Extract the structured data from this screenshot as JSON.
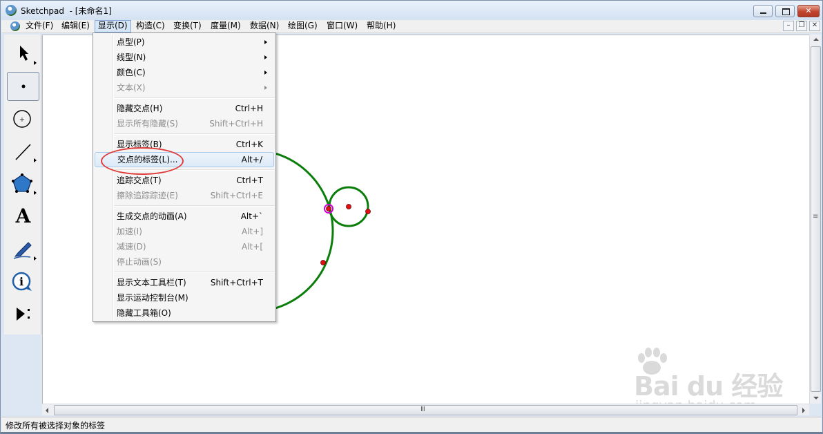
{
  "window": {
    "title": "Sketchpad  - [未命名1]"
  },
  "menubar": {
    "items": [
      {
        "label": "文件(F)",
        "active": false
      },
      {
        "label": "编辑(E)",
        "active": false
      },
      {
        "label": "显示(D)",
        "active": true
      },
      {
        "label": "构造(C)",
        "active": false
      },
      {
        "label": "变换(T)",
        "active": false
      },
      {
        "label": "度量(M)",
        "active": false
      },
      {
        "label": "数据(N)",
        "active": false
      },
      {
        "label": "绘图(G)",
        "active": false
      },
      {
        "label": "窗口(W)",
        "active": false
      },
      {
        "label": "帮助(H)",
        "active": false
      }
    ],
    "mdi_controls": [
      "minimize-doc",
      "restore-doc",
      "close-doc"
    ]
  },
  "toolbox": {
    "tools": [
      {
        "name": "arrow-tool",
        "icon": "select-arrow-icon"
      },
      {
        "name": "point-tool",
        "icon": "point-icon",
        "selected": true
      },
      {
        "name": "compass-tool",
        "icon": "circle-icon"
      },
      {
        "name": "straightedge-tool",
        "icon": "line-icon"
      },
      {
        "name": "polygon-tool",
        "icon": "pentagon-icon"
      },
      {
        "name": "text-tool",
        "icon": "text-A-icon",
        "text": "A"
      },
      {
        "name": "marker-tool",
        "icon": "pen-icon"
      },
      {
        "name": "information-tool",
        "icon": "info-icon"
      },
      {
        "name": "custom-tool",
        "icon": "play-dots-icon"
      }
    ]
  },
  "dropdown": {
    "groups": [
      [
        {
          "label": "点型(P)",
          "submenu": true,
          "disabled": false
        },
        {
          "label": "线型(N)",
          "submenu": true,
          "disabled": false
        },
        {
          "label": "颜色(C)",
          "submenu": true,
          "disabled": false
        },
        {
          "label": "文本(X)",
          "submenu": true,
          "disabled": true
        }
      ],
      [
        {
          "label": "隐藏交点(H)",
          "shortcut": "Ctrl+H",
          "disabled": false
        },
        {
          "label": "显示所有隐藏(S)",
          "shortcut": "Shift+Ctrl+H",
          "disabled": true
        }
      ],
      [
        {
          "label": "显示标签(B)",
          "shortcut": "Ctrl+K",
          "disabled": false
        },
        {
          "label": "交点的标签(L)...",
          "shortcut": "Alt+/",
          "disabled": false,
          "hover": true
        }
      ],
      [
        {
          "label": "追踪交点(T)",
          "shortcut": "Ctrl+T",
          "disabled": false
        },
        {
          "label": "擦除追踪踪迹(E)",
          "shortcut": "Shift+Ctrl+E",
          "disabled": true
        }
      ],
      [
        {
          "label": "生成交点的动画(A)",
          "shortcut": "Alt+`",
          "disabled": false
        },
        {
          "label": "加速(I)",
          "shortcut": "Alt+]",
          "disabled": true
        },
        {
          "label": "减速(D)",
          "shortcut": "Alt+[",
          "disabled": true
        },
        {
          "label": "停止动画(S)",
          "disabled": true
        }
      ],
      [
        {
          "label": "显示文本工具栏(T)",
          "shortcut": "Shift+Ctrl+T",
          "disabled": false
        },
        {
          "label": "显示运动控制台(M)",
          "disabled": false
        },
        {
          "label": "隐藏工具箱(O)",
          "disabled": false
        }
      ]
    ]
  },
  "statusbar": {
    "text": "修改所有被选择对象的标签"
  },
  "watermark": {
    "brand": "Bai du 经验",
    "site": "jingyan.baidu.com"
  },
  "colors": {
    "circle_stroke": "#0a7d0a",
    "point_fill": "#e01010",
    "selected_point_ring": "#d000d0",
    "annotation_ring": "#e03c3c"
  }
}
